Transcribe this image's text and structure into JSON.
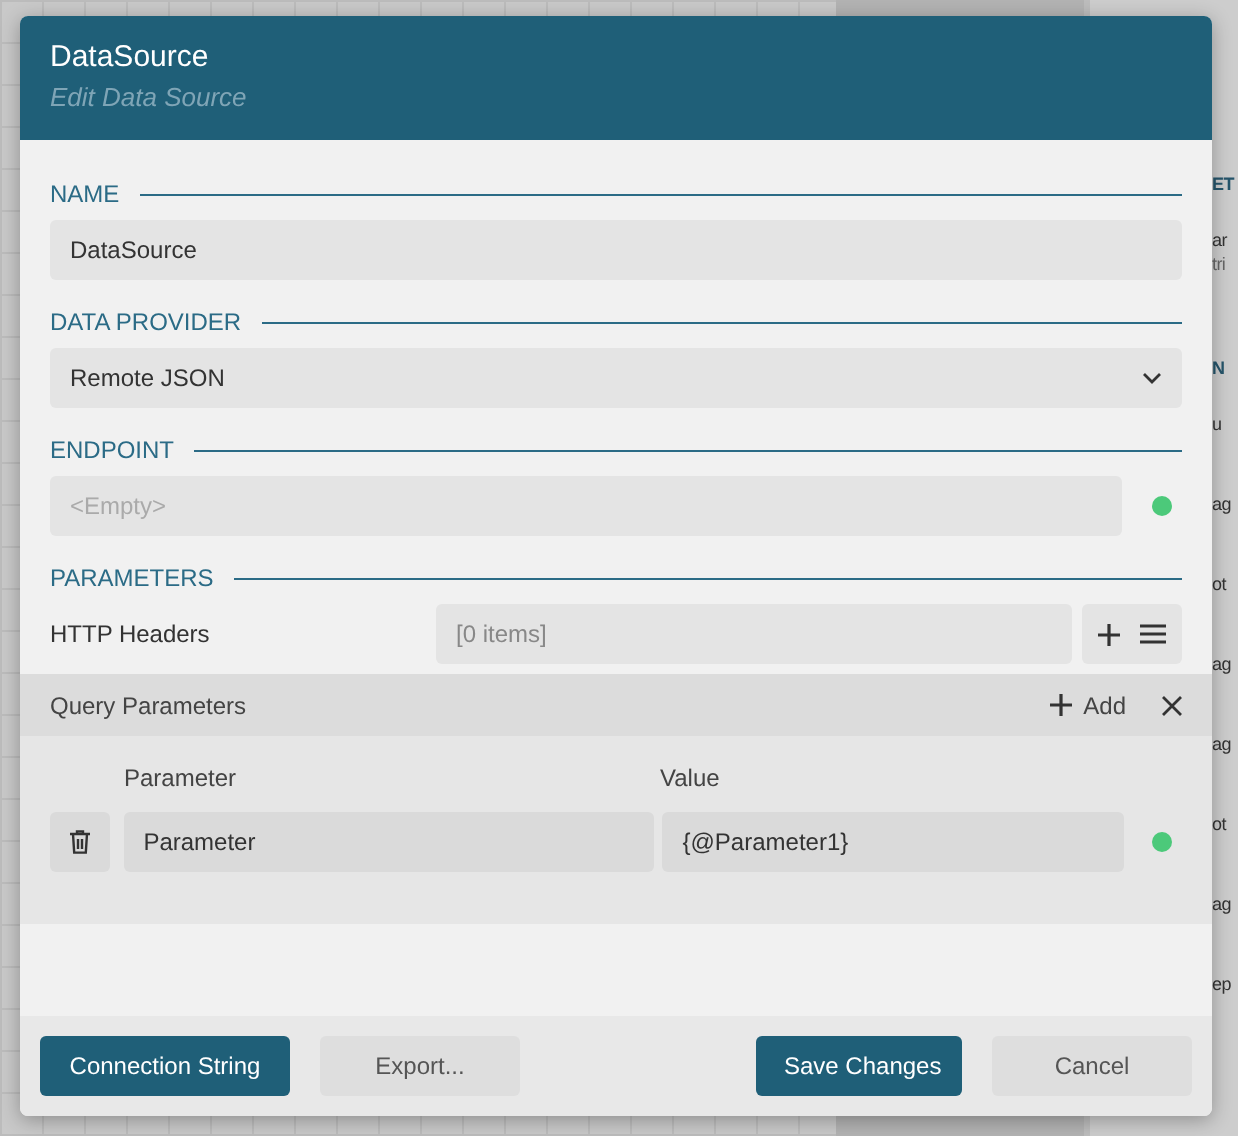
{
  "background": {
    "panel_texts": [
      {
        "text": "ET",
        "kind": "heading"
      },
      {
        "text": "ar",
        "kind": "label"
      },
      {
        "text": "tri",
        "kind": "hint"
      },
      {
        "text": "N",
        "kind": "heading"
      },
      {
        "text": "u",
        "kind": "item"
      },
      {
        "text": "ag",
        "kind": "item"
      },
      {
        "text": "ot",
        "kind": "item"
      },
      {
        "text": "ag",
        "kind": "item"
      },
      {
        "text": "ag",
        "kind": "item"
      },
      {
        "text": "ot",
        "kind": "item"
      },
      {
        "text": "ag",
        "kind": "item"
      },
      {
        "text": "ep",
        "kind": "item"
      }
    ]
  },
  "dialog": {
    "title": "DataSource",
    "subtitle": "Edit Data Source"
  },
  "name": {
    "label": "NAME",
    "value": "DataSource"
  },
  "data_provider": {
    "label": "DATA PROVIDER",
    "value": "Remote JSON"
  },
  "endpoint": {
    "label": "ENDPOINT",
    "placeholder": "<Empty>",
    "valid": true
  },
  "parameters": {
    "label": "PARAMETERS",
    "http_headers": {
      "label": "HTTP Headers",
      "value": "[0 items]"
    },
    "query_parameters": {
      "title": "Query Parameters",
      "add_label": "Add",
      "columns": [
        "Parameter",
        "Value"
      ],
      "rows": [
        {
          "parameter": "Parameter",
          "value": "{@Parameter1}",
          "valid": true
        }
      ]
    }
  },
  "buttons": [
    {
      "label": "Connection String",
      "primary": true
    },
    {
      "label": "Export...",
      "primary": false
    },
    {
      "label": "Save Changes",
      "primary": true
    },
    {
      "label": "Cancel",
      "primary": false
    }
  ]
}
